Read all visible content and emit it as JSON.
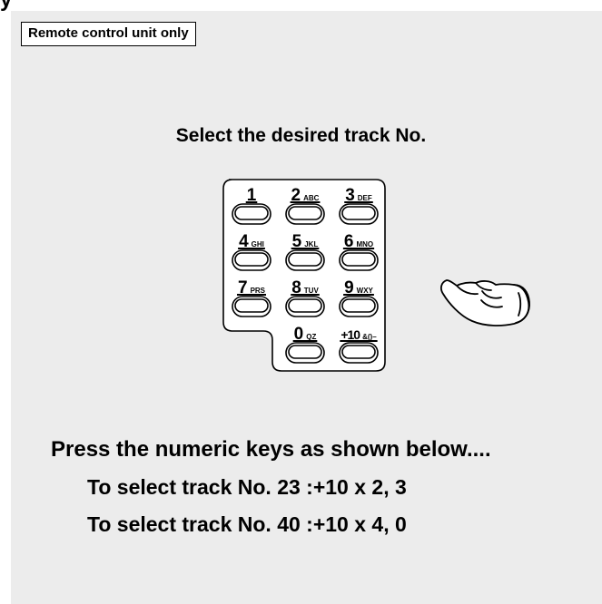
{
  "header": {
    "cut_heading": "y"
  },
  "badge": {
    "label": "Remote control unit only"
  },
  "instruction": {
    "title": "Select the desired track No."
  },
  "keypad": {
    "keys": [
      {
        "num": "1",
        "sub": ""
      },
      {
        "num": "2",
        "sub": "ABC"
      },
      {
        "num": "3",
        "sub": "DEF"
      },
      {
        "num": "4",
        "sub": "GHI"
      },
      {
        "num": "5",
        "sub": "JKL"
      },
      {
        "num": "6",
        "sub": "MNO"
      },
      {
        "num": "7",
        "sub": "PRS"
      },
      {
        "num": "8",
        "sub": "TUV"
      },
      {
        "num": "9",
        "sub": "WXY"
      },
      {
        "num": "0",
        "sub": "QZ"
      },
      {
        "num": "+10",
        "sub": "&()–"
      }
    ]
  },
  "hand_icon": "pointing-hand-icon",
  "notes": {
    "press": "Press the numeric keys as shown below....",
    "example1": "To select track No. 23 :+10 x 2, 3",
    "example2": "To select track No. 40 :+10 x 4, 0"
  }
}
